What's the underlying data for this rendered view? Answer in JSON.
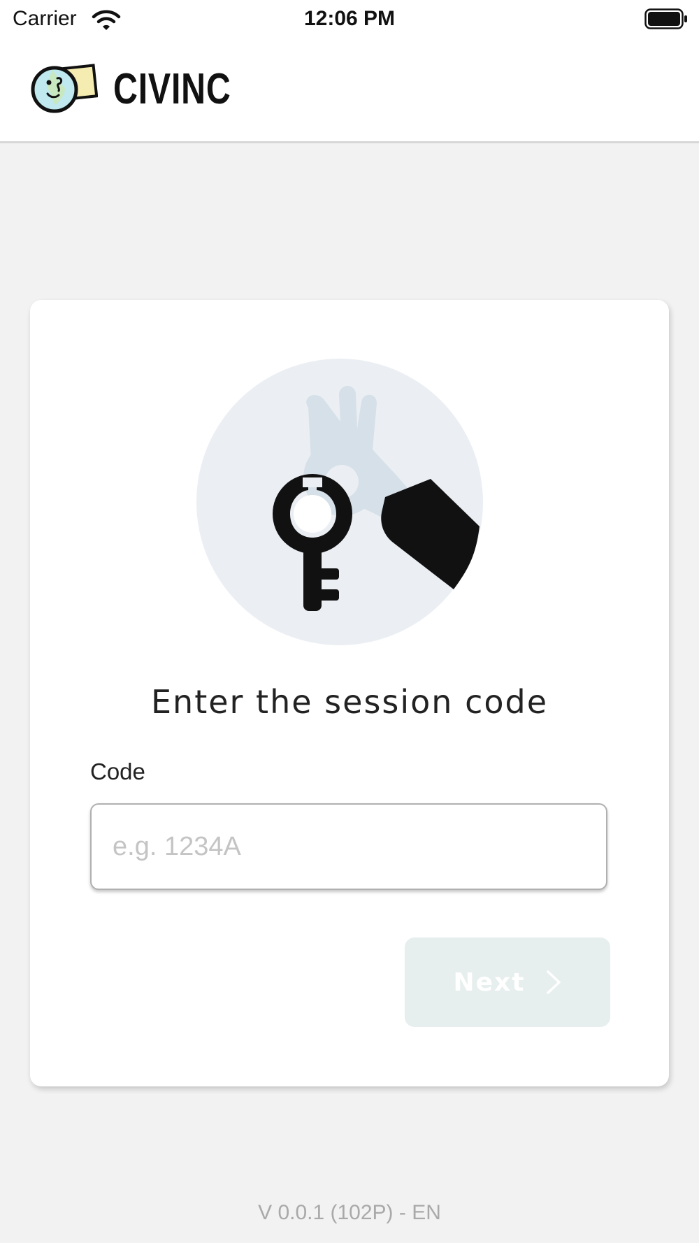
{
  "status_bar": {
    "carrier": "Carrier",
    "time": "12:06 PM"
  },
  "header": {
    "brand": "CIVINC",
    "logo": "civinc-logo"
  },
  "card": {
    "illustration": "hand-handing-key-illustration",
    "title": "Enter the session code",
    "code_label": "Code",
    "code_value": "",
    "code_placeholder": "e.g. 1234A",
    "next_label": "Next",
    "next_icon": "chevron-right-icon"
  },
  "footer": {
    "version": "V 0.0.1 (102P) - EN"
  },
  "colors": {
    "page_background": "#f2f2f2",
    "card_background": "#ffffff",
    "button_disabled_background": "#e6eeee",
    "button_text": "#ffffff",
    "illustration_circle": "#ebeff3",
    "illustration_hand": "#d6e0e8",
    "logo_globe": "#bfe8ef",
    "logo_note": "#f5ecb2"
  }
}
